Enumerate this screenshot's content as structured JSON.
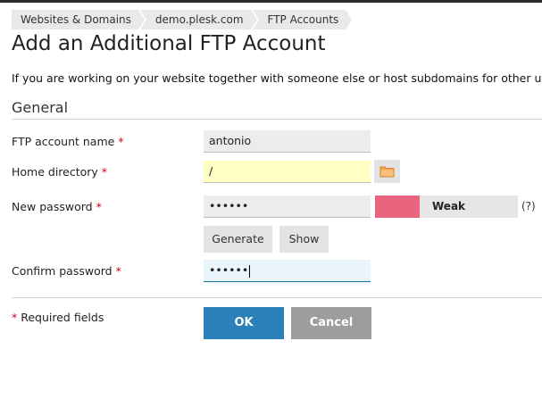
{
  "breadcrumb": [
    "Websites & Domains",
    "demo.plesk.com",
    "FTP Accounts"
  ],
  "page_title": "Add an Additional FTP Account",
  "intro_text": "If you are working on your website together with someone else or host subdomains for other users,",
  "section_title": "General",
  "fields": {
    "ftp_account_name": {
      "label": "FTP account name",
      "value": "antonio"
    },
    "home_directory": {
      "label": "Home directory",
      "value": "/"
    },
    "new_password": {
      "label": "New password",
      "value": "••••••"
    },
    "confirm_password": {
      "label": "Confirm password",
      "value": "••••••"
    }
  },
  "required_marker": "*",
  "password_strength": {
    "label": "Weak",
    "color": "#e8647f"
  },
  "help_label": "(?)",
  "buttons": {
    "generate": "Generate",
    "show": "Show",
    "ok": "OK",
    "cancel": "Cancel"
  },
  "required_note": "Required fields",
  "icons": {
    "home_directory_browse": "folder-icon"
  },
  "colors": {
    "primary": "#2a80b9",
    "cancel": "#9d9d9d",
    "required": "#d0021b"
  }
}
